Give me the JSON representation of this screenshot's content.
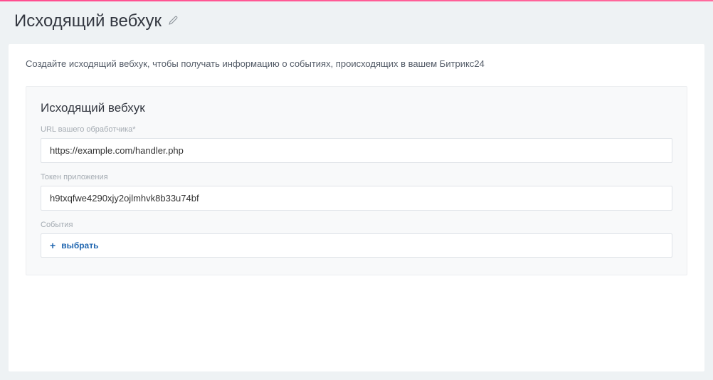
{
  "header": {
    "title": "Исходящий вебхук"
  },
  "card": {
    "description": "Создайте исходящий вебхук, чтобы получать информацию о событиях, происходящих в вашем Битрикс24",
    "section_title": "Исходящий вебхук",
    "fields": {
      "handler_url": {
        "label": "URL вашего обработчика*",
        "value": "https://example.com/handler.php"
      },
      "app_token": {
        "label": "Токен приложения",
        "value": "h9txqfwe4290xjy2ojlmhvk8b33u74bf"
      },
      "events": {
        "label": "События",
        "select_label": "выбрать",
        "plus": "+"
      }
    }
  }
}
